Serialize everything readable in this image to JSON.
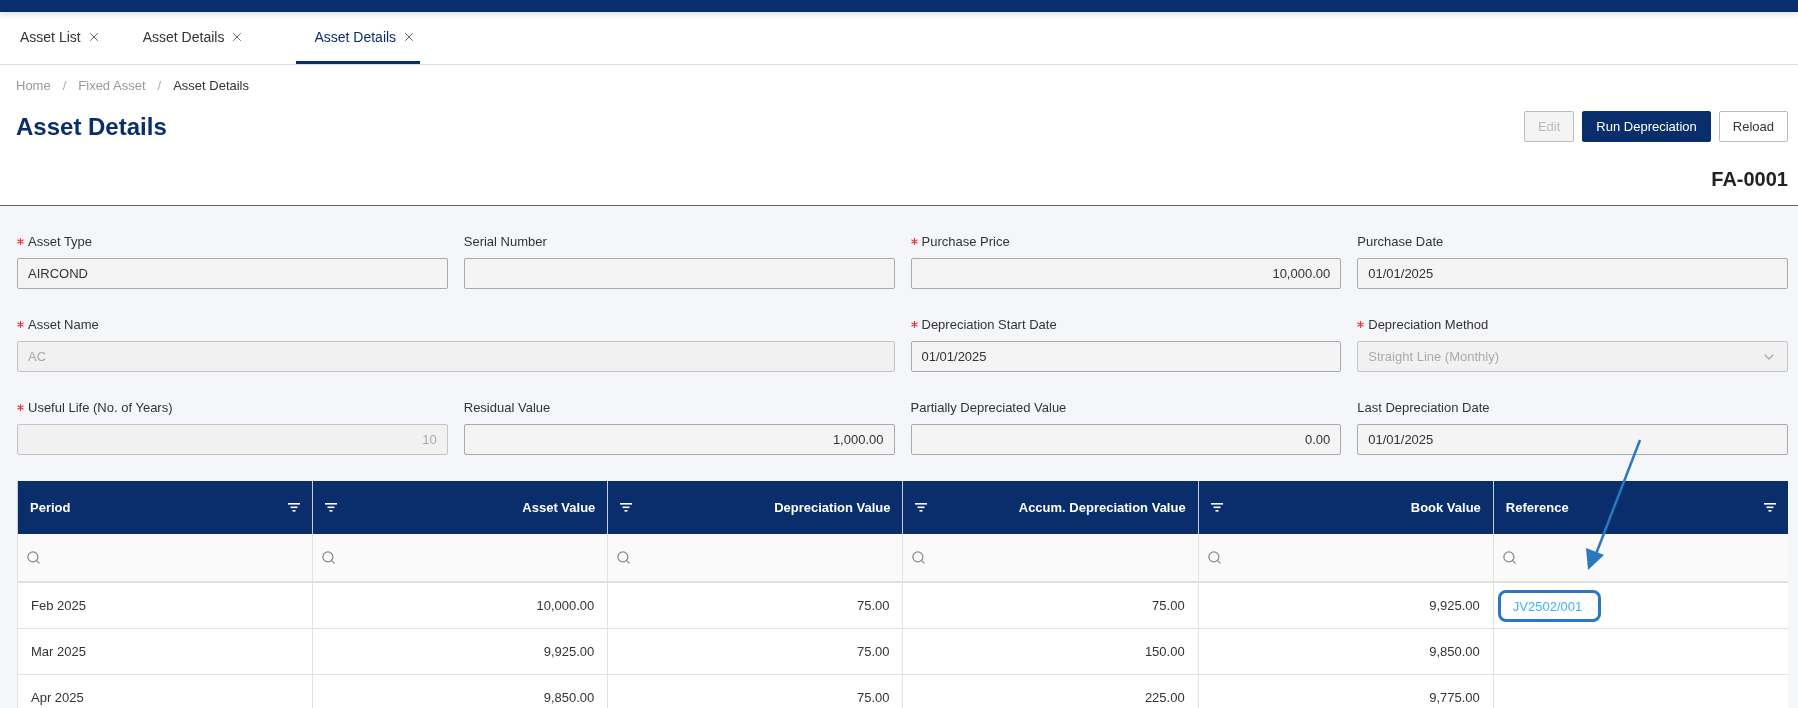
{
  "tabs": [
    {
      "label": "Asset List",
      "selected": false
    },
    {
      "label": "Asset Details",
      "selected": false
    },
    {
      "label": "Asset Details",
      "selected": true
    }
  ],
  "breadcrumb": {
    "separator": "/",
    "items": [
      {
        "label": "Home",
        "current": false
      },
      {
        "label": "Fixed Asset",
        "current": false
      },
      {
        "label": "Asset Details",
        "current": true
      }
    ]
  },
  "page_title": "Asset Details",
  "actions": [
    {
      "label": "Edit",
      "kind": "default",
      "disabled": true
    },
    {
      "label": "Run Depreciation",
      "kind": "primary",
      "disabled": false
    },
    {
      "label": "Reload",
      "kind": "default",
      "disabled": false
    }
  ],
  "record_code": "FA-0001",
  "fields": [
    {
      "label": "Asset Type",
      "required": true,
      "kind": "text",
      "value": "AIRCOND",
      "disabled": false,
      "wide": false
    },
    {
      "label": "Serial Number",
      "required": false,
      "kind": "text",
      "disabled": false,
      "wide": false
    },
    {
      "label": "Purchase Price",
      "required": true,
      "kind": "number",
      "value": "10,000.00",
      "disabled": false,
      "wide": false
    },
    {
      "label": "Purchase Date",
      "required": false,
      "kind": "text",
      "value": "01/01/2025",
      "disabled": false,
      "wide": false
    },
    {
      "label": "Asset Name",
      "required": true,
      "kind": "text",
      "value": "AC",
      "disabled": true,
      "wide": true
    },
    {
      "label": "Depreciation Start Date",
      "required": true,
      "kind": "text",
      "value": "01/01/2025",
      "disabled": false,
      "wide": false
    },
    {
      "label": "Depreciation Method",
      "required": true,
      "kind": "select",
      "value": "Straight Line (Monthly)",
      "disabled": true,
      "wide": false
    },
    {
      "label": "Useful Life (No. of Years)",
      "required": true,
      "kind": "number",
      "value": "10",
      "disabled": true,
      "wide": false
    },
    {
      "label": "Residual Value",
      "required": false,
      "kind": "number",
      "value": "1,000.00",
      "disabled": false,
      "wide": false
    },
    {
      "label": "Partially Depreciated Value",
      "required": false,
      "kind": "number",
      "value": "0.00",
      "disabled": false,
      "wide": false
    },
    {
      "label": "Last Depreciation Date",
      "required": false,
      "kind": "text",
      "value": "01/01/2025",
      "disabled": false,
      "wide": false
    }
  ],
  "table": {
    "columns": [
      {
        "label": "Period",
        "kind": "text"
      },
      {
        "label": "Asset Value",
        "kind": "number"
      },
      {
        "label": "Depreciation Value",
        "kind": "number"
      },
      {
        "label": "Accum. Depreciation Value",
        "kind": "number"
      },
      {
        "label": "Book Value",
        "kind": "number"
      },
      {
        "label": "Reference",
        "kind": "link"
      }
    ],
    "rows": [
      {
        "cells": [
          "Feb 2025",
          "10,000.00",
          "75.00",
          "75.00",
          "9,925.00",
          "JV2502/001"
        ],
        "highlighted": true
      },
      {
        "cells": [
          "Mar 2025",
          "9,925.00",
          "75.00",
          "150.00",
          "9,850.00"
        ],
        "highlighted": false
      },
      {
        "cells": [
          "Apr 2025",
          "9,850.00",
          "75.00",
          "225.00",
          "9,775.00"
        ],
        "highlighted": false
      }
    ]
  }
}
